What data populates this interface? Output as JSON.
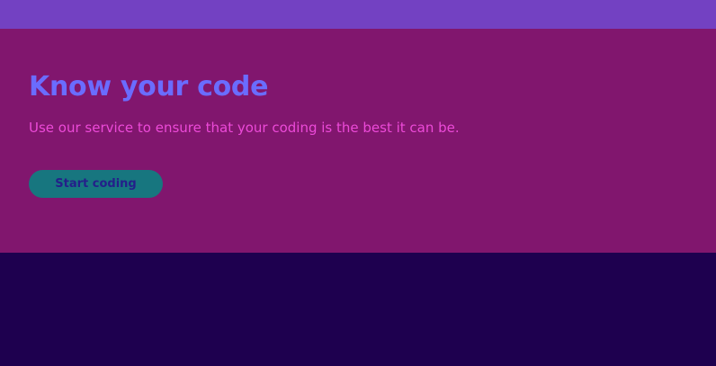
{
  "colors": {
    "topbar": "#7341c2",
    "hero_background": "#81166e",
    "page_background": "#1e004f",
    "title": "#6a6cff",
    "subtitle": "#ec4ad8",
    "button_background": "#17767f",
    "button_text": "#241f8a"
  },
  "hero": {
    "title": "Know your code",
    "subtitle": "Use our service to ensure that your coding is the best it can be.",
    "cta_label": "Start coding"
  }
}
